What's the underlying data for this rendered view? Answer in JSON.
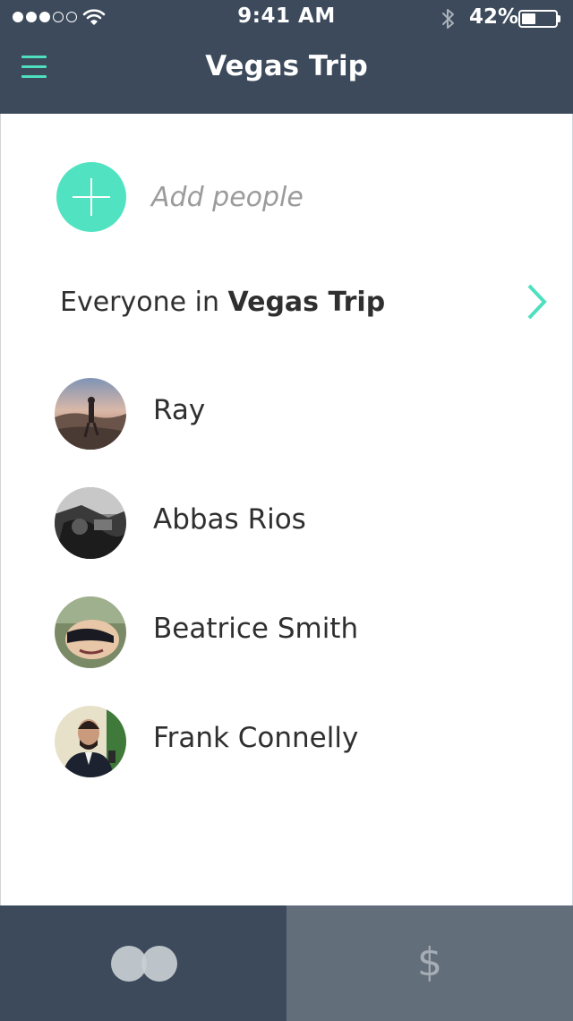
{
  "status_bar": {
    "time": "9:41 AM",
    "battery_percent": "42%",
    "battery_level": 0.42,
    "signal_full": 3,
    "signal_total": 5
  },
  "header": {
    "title": "Vegas Trip",
    "menu_icon": "hamburger-menu-icon",
    "accent_color": "#4fdfbf",
    "background_color": "#3c4a5b"
  },
  "add_people": {
    "label": "Add people",
    "icon": "plus-icon",
    "color": "#51e3c1"
  },
  "everyone": {
    "prefix": "Everyone in",
    "group_name": "Vegas Trip",
    "icon": "chevron-right-icon"
  },
  "people": [
    {
      "name": "Ray",
      "avatar": "desert-sunset-photo"
    },
    {
      "name": "Abbas Rios",
      "avatar": "monochrome-photo"
    },
    {
      "name": "Beatrice Smith",
      "avatar": "selfie-sunglasses-photo"
    },
    {
      "name": "Frank Connelly",
      "avatar": "man-suit-selfie-photo"
    }
  ],
  "tabs": [
    {
      "name": "people",
      "icon": "overlapping-circles-icon",
      "active": true
    },
    {
      "name": "expenses",
      "icon": "dollar-icon",
      "label": "$",
      "active": false
    }
  ]
}
